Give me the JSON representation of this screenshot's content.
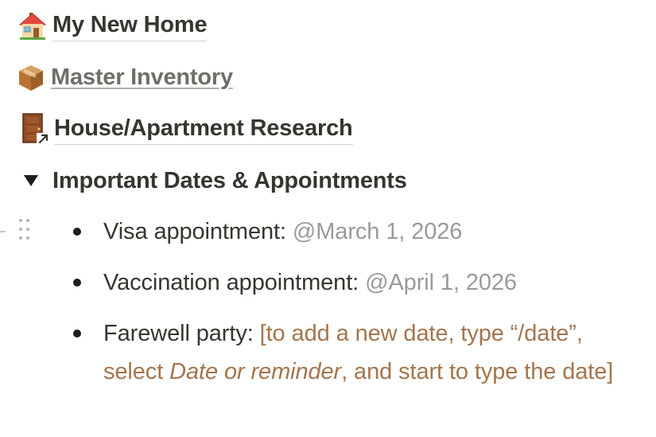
{
  "page_links": [
    {
      "icon": "house-icon",
      "title": "My New Home"
    },
    {
      "icon": "package-icon",
      "title": "Master Inventory"
    },
    {
      "icon": "door-icon",
      "title": "House/Apartment Research"
    }
  ],
  "toggle": {
    "title": "Important Dates & Appointments",
    "state": "expanded"
  },
  "items": [
    {
      "label": "Visa appointment:",
      "mention": "@March 1, 2026"
    },
    {
      "label": "Vaccination appointment:",
      "mention": "@April 1, 2026"
    },
    {
      "label": "Farewell party:",
      "hint_part1": "[to add a new date, type “/date”, select ",
      "hint_italic": "Date or reminder",
      "hint_part2": ", and start to type the date]"
    }
  ],
  "colors": {
    "text": "#37352f",
    "mention": "#9b9a97",
    "hint": "#a4754d",
    "muted_link": "#6f6e69"
  }
}
